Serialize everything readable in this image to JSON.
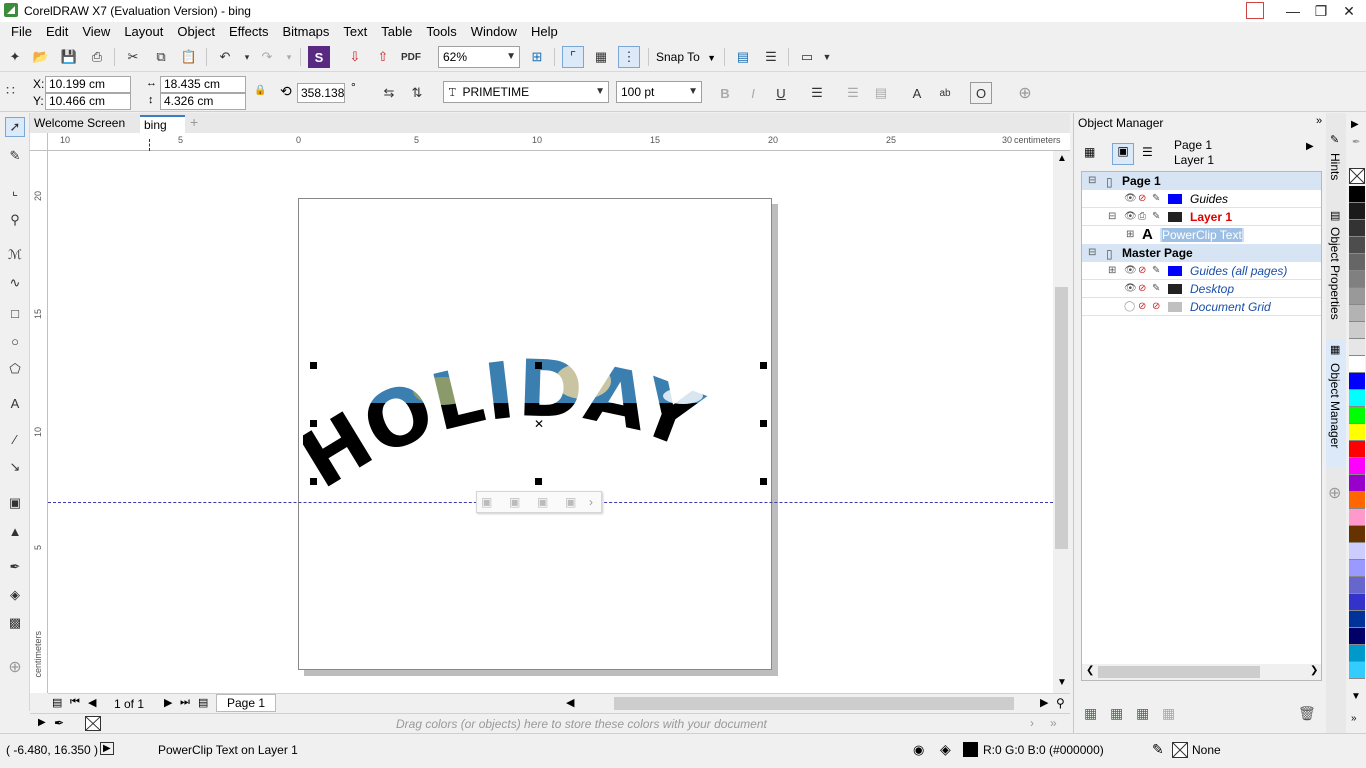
{
  "window": {
    "title": "CorelDRAW X7 (Evaluation Version) - bing"
  },
  "menu": [
    "File",
    "Edit",
    "View",
    "Layout",
    "Object",
    "Effects",
    "Bitmaps",
    "Text",
    "Table",
    "Tools",
    "Window",
    "Help"
  ],
  "toolbar": {
    "zoom": "62%",
    "snap_to": "Snap To"
  },
  "propbar": {
    "x_label": "X:",
    "x_value": "10.199 cm",
    "y_label": "Y:",
    "y_value": "10.466 cm",
    "width_value": "18.435 cm",
    "height_value": "4.326 cm",
    "rotation": "358.138",
    "degree": "°",
    "font": "PRIMETIME",
    "font_size": "100 pt"
  },
  "tabs": {
    "welcome": "Welcome Screen",
    "doc": "bing"
  },
  "ruler": {
    "top": [
      "10",
      "5",
      "0",
      "5",
      "10",
      "15",
      "20",
      "25",
      "30"
    ],
    "unit_top": "centimeters",
    "left": [
      "20",
      "15",
      "10",
      "5"
    ],
    "unit_left": "centimeters"
  },
  "canvas": {
    "art_text": "HOLIDAY"
  },
  "pagenav": {
    "count": "1 of 1",
    "page_tab": "Page 1"
  },
  "colorstrip": {
    "hint": "Drag colors (or objects) here to store these colors with your document"
  },
  "status": {
    "coords": "( -6.480, 16.350 )",
    "message": "PowerClip Text on Layer 1",
    "fill_info": "R:0 G:0 B:0 (#000000)",
    "outline": "None"
  },
  "docker": {
    "title": "Object Manager",
    "current_page": "Page 1",
    "current_layer": "Layer 1",
    "rows": {
      "page1": "Page 1",
      "guides": "Guides",
      "layer1": "Layer 1",
      "powerclip": "PowerClip Text",
      "master": "Master Page",
      "guides_all": "Guides (all pages)",
      "desktop": "Desktop",
      "docgrid": "Document Grid"
    },
    "colors": {
      "guides": "#0000ff",
      "layer1": "#222222",
      "guides_all": "#0000ff",
      "desktop": "#222222",
      "docgrid": "#c0c0c0",
      "layer1_text": "#e00000",
      "master_text": "#1a4fa8"
    }
  },
  "sidetabs": {
    "hints": "Hints",
    "props": "Object Properties",
    "manager": "Object Manager"
  },
  "palette": [
    "#000000",
    "#1a1a1a",
    "#333333",
    "#4d4d4d",
    "#666666",
    "#808080",
    "#999999",
    "#b3b3b3",
    "#cccccc",
    "#e6e6e6",
    "#ffffff",
    "#0000ff",
    "#00ffff",
    "#00ff00",
    "#ffff00",
    "#ff0000",
    "#ff00ff",
    "#9900cc",
    "#ff6600",
    "#ff99cc",
    "#663300",
    "#ccccff",
    "#9999ff",
    "#6666cc",
    "#3333cc",
    "#003399",
    "#000066",
    "#0099cc",
    "#33ccff"
  ]
}
